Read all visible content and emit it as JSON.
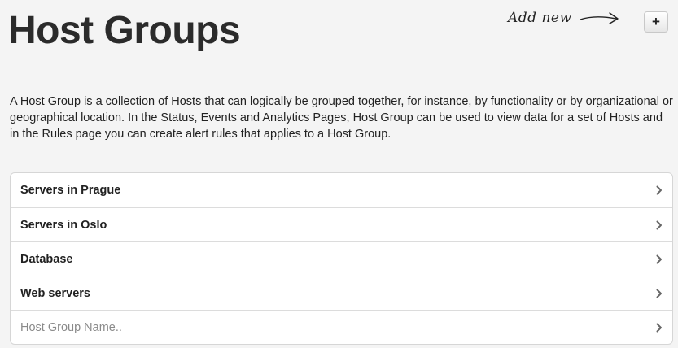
{
  "header": {
    "title": "Host Groups",
    "add_new_hint": "Add new",
    "add_button_label": "+"
  },
  "description": "A Host Group is a collection of Hosts that can logically be grouped together, for instance, by functionality or by organizational or geographical location. In the Status, Events and Analytics Pages, Host Group can be used to view data for a set of Hosts and in the Rules page you can create alert rules that applies to a Host Group.",
  "host_groups": [
    {
      "label": "Servers in Prague"
    },
    {
      "label": "Servers in Oslo"
    },
    {
      "label": "Database"
    },
    {
      "label": "Web servers"
    }
  ],
  "new_group_input": {
    "value": "",
    "placeholder": "Host Group Name.."
  },
  "icons": {
    "arrow": "arrow-right-icon",
    "row_chevron": "chevron-right-icon"
  },
  "colors": {
    "background": "#f4f4f4",
    "title": "#2b2b2b",
    "chevron": "#666666",
    "placeholder": "#8a8a8a"
  }
}
